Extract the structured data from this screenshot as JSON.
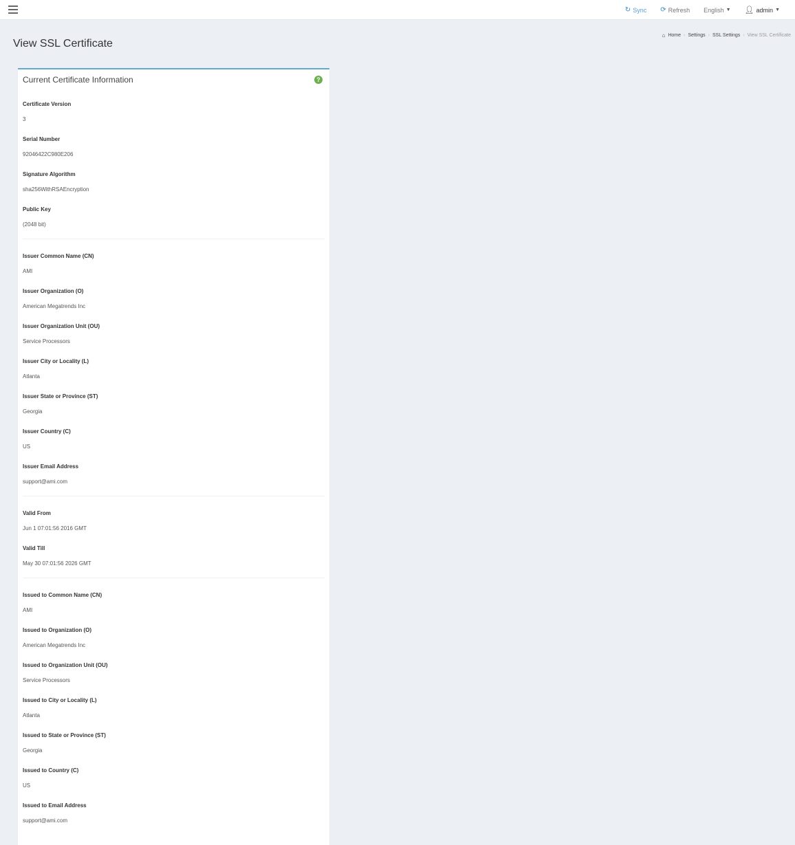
{
  "topnav": {
    "sync_label": "Sync",
    "refresh_label": "Refresh",
    "language_label": "English",
    "user_label": "admin",
    "accent_color": "#3c8dbc"
  },
  "page": {
    "title": "View SSL Certificate"
  },
  "breadcrumb": [
    "Home",
    "Settings",
    "SSL Settings",
    "View SSL Certificate"
  ],
  "box": {
    "title": "Current Certificate Information",
    "help_icon": "?",
    "groups": [
      [
        {
          "label": "Certificate Version",
          "value": "3"
        },
        {
          "label": "Serial Number",
          "value": "92046422C980E206"
        },
        {
          "label": "Signature Algorithm",
          "value": "sha256WithRSAEncryption"
        },
        {
          "label": "Public Key",
          "value": "(2048 bit)"
        }
      ],
      [
        {
          "label": "Issuer Common Name (CN)",
          "value": "AMI"
        },
        {
          "label": "Issuer Organization (O)",
          "value": "American Megatrends Inc"
        },
        {
          "label": "Issuer Organization Unit (OU)",
          "value": "Service Processors"
        },
        {
          "label": "Issuer City or Locality (L)",
          "value": "Atlanta"
        },
        {
          "label": "Issuer State or Province (ST)",
          "value": "Georgia"
        },
        {
          "label": "Issuer Country (C)",
          "value": "US"
        },
        {
          "label": "Issuer Email Address",
          "value": "support@ami.com"
        }
      ],
      [
        {
          "label": "Valid From",
          "value": "Jun 1 07:01:56 2016 GMT"
        },
        {
          "label": "Valid Till",
          "value": "May 30 07:01:56 2026 GMT"
        }
      ],
      [
        {
          "label": "Issued to Common Name (CN)",
          "value": "AMI"
        },
        {
          "label": "Issued to Organization (O)",
          "value": "American Megatrends Inc"
        },
        {
          "label": "Issued to Organization Unit (OU)",
          "value": "Service Processors"
        },
        {
          "label": "Issued to City or Locality (L)",
          "value": "Atlanta"
        },
        {
          "label": "Issued to State or Province (ST)",
          "value": "Georgia"
        },
        {
          "label": "Issued to Country (C)",
          "value": "US"
        },
        {
          "label": "Issued to Email Address",
          "value": "support@ami.com"
        }
      ]
    ]
  }
}
